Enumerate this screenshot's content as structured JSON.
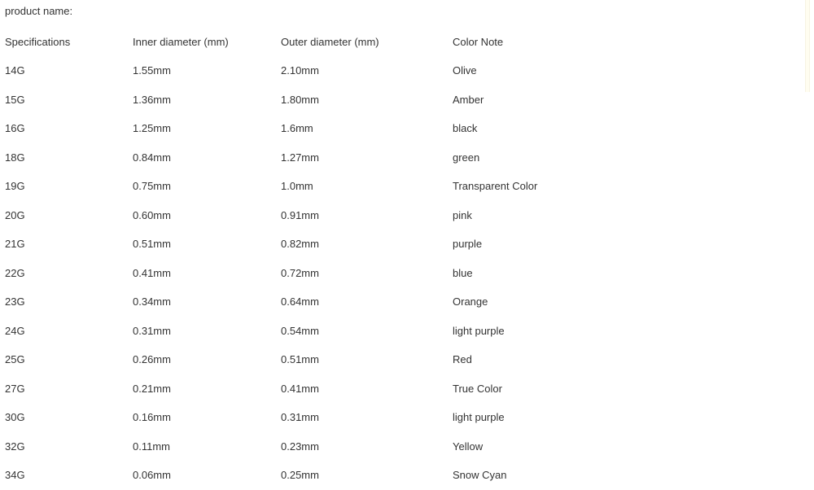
{
  "page": {
    "product_name_label": "product name:",
    "right_rule_color": "#fffdf0",
    "text_color": "#333333",
    "background_color": "#ffffff"
  },
  "table": {
    "headers": [
      "Specifications",
      "Inner diameter (mm)",
      "Outer diameter (mm)",
      "Color Note"
    ],
    "rows": [
      {
        "spec": "14G",
        "inner": "1.55mm",
        "outer": "2.10mm",
        "color_note": "Olive"
      },
      {
        "spec": "15G",
        "inner": "1.36mm",
        "outer": "1.80mm",
        "color_note": "Amber"
      },
      {
        "spec": "16G",
        "inner": "1.25mm",
        "outer": "1.6mm",
        "color_note": "black"
      },
      {
        "spec": "18G",
        "inner": "0.84mm",
        "outer": "1.27mm",
        "color_note": "green"
      },
      {
        "spec": "19G",
        "inner": "0.75mm",
        "outer": "1.0mm",
        "color_note": "Transparent Color"
      },
      {
        "spec": "20G",
        "inner": "0.60mm",
        "outer": "0.91mm",
        "color_note": "pink"
      },
      {
        "spec": "21G",
        "inner": "0.51mm",
        "outer": "0.82mm",
        "color_note": "purple"
      },
      {
        "spec": "22G",
        "inner": "0.41mm",
        "outer": "0.72mm",
        "color_note": "blue"
      },
      {
        "spec": "23G",
        "inner": "0.34mm",
        "outer": "0.64mm",
        "color_note": "Orange"
      },
      {
        "spec": "24G",
        "inner": "0.31mm",
        "outer": "0.54mm",
        "color_note": "light purple"
      },
      {
        "spec": "25G",
        "inner": "0.26mm",
        "outer": "0.51mm",
        "color_note": "Red"
      },
      {
        "spec": "27G",
        "inner": "0.21mm",
        "outer": "0.41mm",
        "color_note": "True Color"
      },
      {
        "spec": "30G",
        "inner": "0.16mm",
        "outer": "0.31mm",
        "color_note": "light purple"
      },
      {
        "spec": "32G",
        "inner": "0.11mm",
        "outer": "0.23mm",
        "color_note": "Yellow"
      },
      {
        "spec": "34G",
        "inner": "0.06mm",
        "outer": "0.25mm",
        "color_note": "Snow Cyan"
      }
    ]
  }
}
